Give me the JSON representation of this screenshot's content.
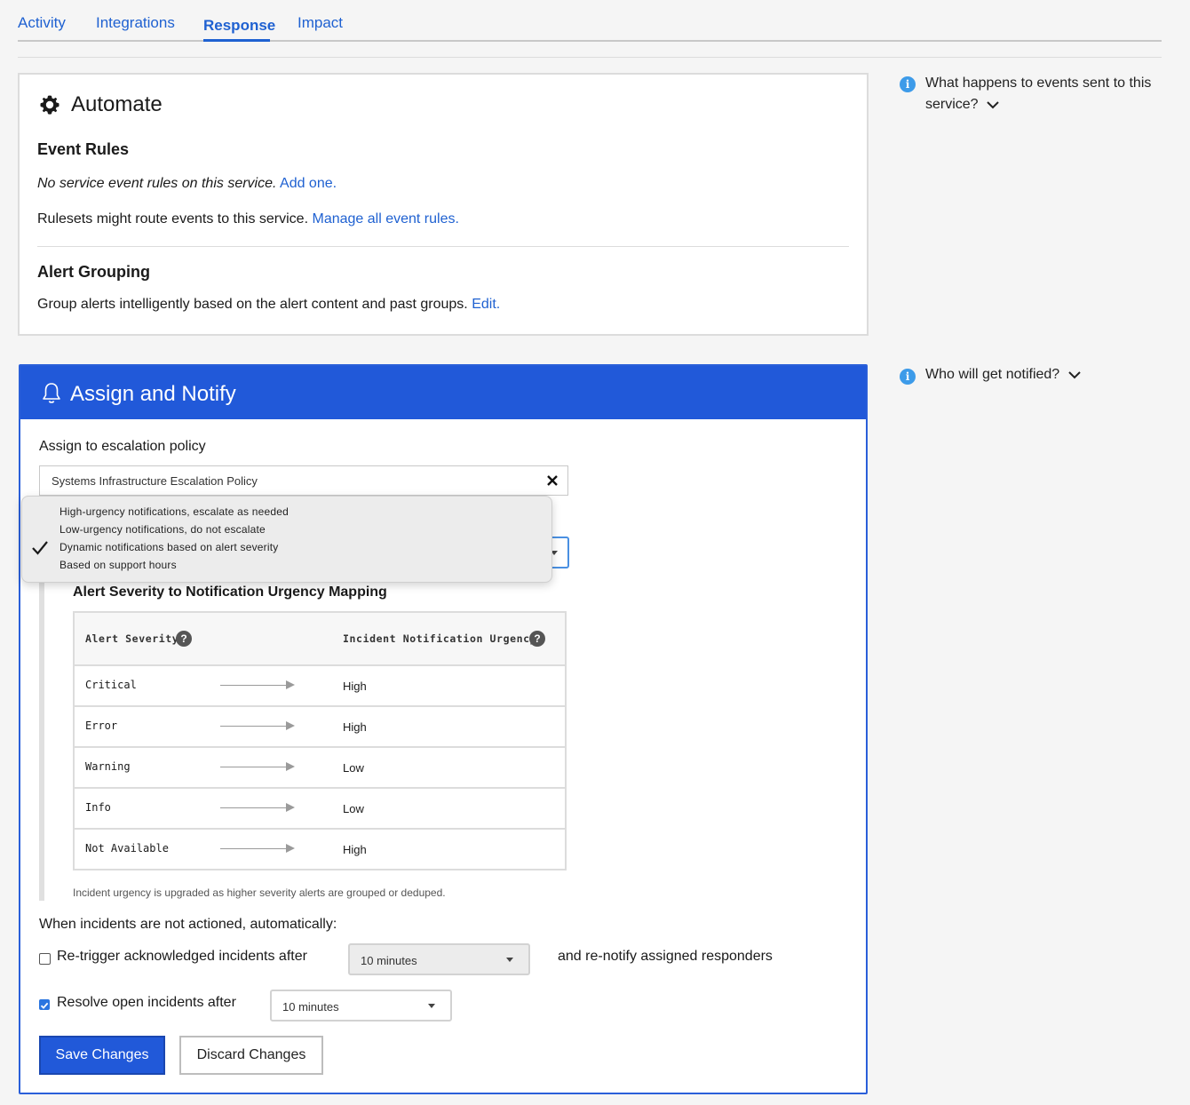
{
  "tabs": [
    "Activity",
    "Integrations",
    "Response",
    "Impact"
  ],
  "active_tab": "Response",
  "automate": {
    "title": "Automate",
    "event_rules_heading": "Event Rules",
    "no_rules_text": "No service event rules on this service.",
    "add_one_link": "Add one.",
    "rulesets_text": "Rulesets might route events to this service.",
    "manage_link": "Manage all event rules.",
    "alert_grouping_heading": "Alert Grouping",
    "grouping_text": "Group alerts intelligently based on the alert content and past groups.",
    "edit_link": "Edit."
  },
  "notify": {
    "title": "Assign and Notify",
    "escalation_label": "Assign to escalation policy",
    "escalation_value": "Systems Infrastructure Escalation Policy",
    "urgency_options": [
      "High-urgency notifications, escalate as needed",
      "Low-urgency notifications, do not escalate",
      "Dynamic notifications based on alert severity",
      "Based on support hours"
    ],
    "urgency_selected_index": 2,
    "mapping_heading": "Alert Severity to Notification Urgency Mapping",
    "col_severity": "Alert Severity",
    "col_urgency": "Incident Notification Urgency",
    "rows": [
      {
        "severity": "Critical",
        "urgency": "High"
      },
      {
        "severity": "Error",
        "urgency": "High"
      },
      {
        "severity": "Warning",
        "urgency": "Low"
      },
      {
        "severity": "Info",
        "urgency": "Low"
      },
      {
        "severity": "Not Available",
        "urgency": "High"
      }
    ],
    "mapping_note": "Incident urgency is upgraded as higher severity alerts are grouped or deduped.",
    "not_actioned_label": "When incidents are not actioned, automatically:",
    "retrigger_label": "Re-trigger acknowledged incidents after",
    "retrigger_checked": false,
    "retrigger_value": "10 minutes",
    "renotify_text": "and re-notify assigned responders",
    "resolve_label": "Resolve open incidents after",
    "resolve_checked": true,
    "resolve_value": "10 minutes",
    "save_button": "Save Changes",
    "discard_button": "Discard Changes"
  },
  "sidebar": {
    "events_question": "What happens to events sent to this service?",
    "notified_question": "Who will get notified?"
  },
  "colors": {
    "accent": "#2159d9",
    "link": "#1f61d1",
    "info": "#3d9be9"
  }
}
